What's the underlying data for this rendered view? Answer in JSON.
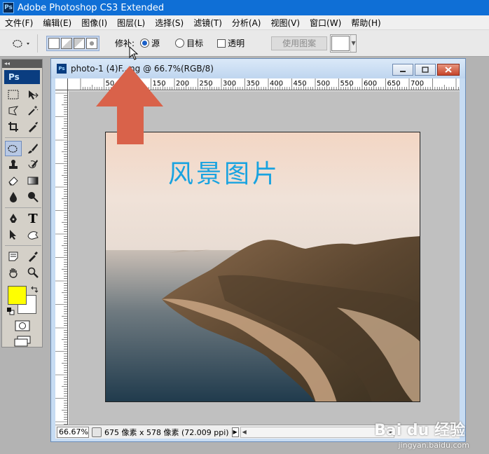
{
  "window": {
    "title": "Adobe Photoshop CS3 Extended",
    "icon": "Ps"
  },
  "menu": [
    "文件(F)",
    "编辑(E)",
    "图像(I)",
    "图层(L)",
    "选择(S)",
    "滤镜(T)",
    "分析(A)",
    "视图(V)",
    "窗口(W)",
    "帮助(H)"
  ],
  "options": {
    "patch_label": "修补:",
    "source_label": "源",
    "target_label": "目标",
    "transparent_label": "透明",
    "use_pattern_label": "使用图案",
    "source_selected": true
  },
  "toolbox": {
    "logo": "Ps",
    "foreground_color": "#ffff00",
    "background_color": "#ffffff"
  },
  "document": {
    "title": "photo-1 (4)F...ng @ 66.7%(RGB/8)",
    "icon": "Ps",
    "ruler_labels": [
      "50",
      "100",
      "150",
      "200",
      "250",
      "300",
      "350",
      "400",
      "450",
      "500",
      "550",
      "600",
      "650",
      "700"
    ],
    "image_caption": "风景图片",
    "zoom": "66.67%",
    "status_text": "675 像素 x 578 像素 (72.009 ppi)"
  },
  "watermark": {
    "brand": "Bai du 经验",
    "url": "jingyan.baidu.com"
  },
  "colors": {
    "annotation_arrow": "#d9624a",
    "caption": "#19a3e0",
    "titlebar": "#0f6fd6"
  }
}
